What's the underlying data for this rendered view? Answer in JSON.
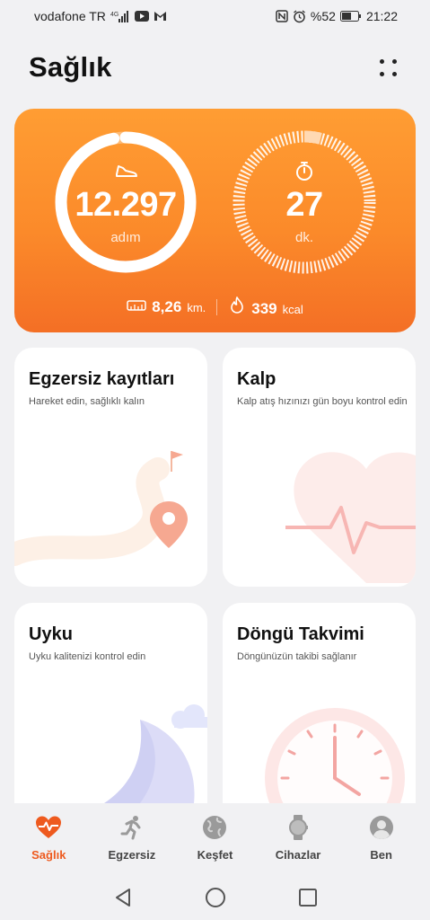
{
  "status_bar": {
    "carrier": "vodafone TR",
    "battery_percent": "%52",
    "time": "21:22"
  },
  "header": {
    "title": "Sağlık"
  },
  "activity": {
    "steps_value": "12.297",
    "steps_unit": "adım",
    "steps_progress": 0.97,
    "minutes_value": "27",
    "minutes_unit": "dk.",
    "minutes_progress": 0.04,
    "distance_value": "8,26",
    "distance_unit": "km.",
    "calories_value": "339",
    "calories_unit": "kcal"
  },
  "cards": {
    "exercise": {
      "title": "Egzersiz kayıtları",
      "subtitle": "Hareket edin, sağlıklı kalın"
    },
    "heart": {
      "title": "Kalp",
      "subtitle": "Kalp atış hızınızı gün boyu kontrol edin"
    },
    "sleep": {
      "title": "Uyku",
      "subtitle": "Uyku kalitenizi kontrol edin"
    },
    "cycle": {
      "title": "Döngü Takvimi",
      "subtitle": "Döngünüzün takibi sağlanır"
    }
  },
  "bottom_nav": {
    "items": [
      {
        "label": "Sağlık",
        "icon": "heart-pulse-icon"
      },
      {
        "label": "Egzersiz",
        "icon": "running-icon"
      },
      {
        "label": "Keşfet",
        "icon": "globe-icon"
      },
      {
        "label": "Cihazlar",
        "icon": "watch-icon"
      },
      {
        "label": "Ben",
        "icon": "user-icon"
      }
    ]
  },
  "colors": {
    "accent": "#ee5a1e",
    "card_orange": "#fb8a2a"
  }
}
